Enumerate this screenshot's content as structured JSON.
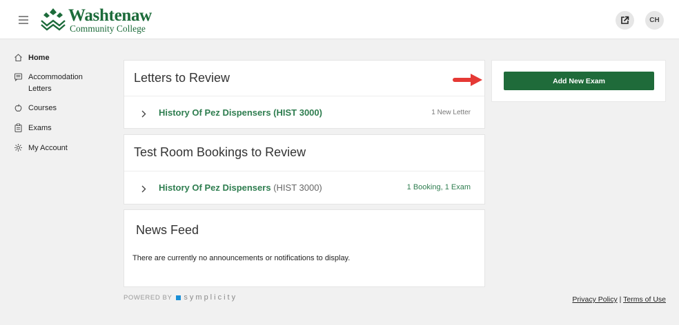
{
  "header": {
    "logo_name": "Washtenaw",
    "logo_sub": "Community College",
    "user_initials": "CH"
  },
  "sidebar": {
    "items": [
      {
        "label": "Home",
        "icon": "home-icon",
        "active": true
      },
      {
        "label": "Accommodation Letters",
        "icon": "letters-icon",
        "active": false
      },
      {
        "label": "Courses",
        "icon": "apple-icon",
        "active": false
      },
      {
        "label": "Exams",
        "icon": "clipboard-icon",
        "active": false
      },
      {
        "label": "My Account",
        "icon": "gear-icon",
        "active": false
      }
    ]
  },
  "letters": {
    "title": "Letters to Review",
    "rows": [
      {
        "course": "History Of Pez Dispensers (HIST 3000)",
        "meta": "1 New Letter"
      }
    ]
  },
  "bookings": {
    "title": "Test Room Bookings to Review",
    "rows": [
      {
        "course": "History Of Pez Dispensers",
        "code": "(HIST 3000)",
        "meta": "1 Booking, 1 Exam"
      }
    ]
  },
  "news": {
    "title": "News Feed",
    "empty_text": "There are currently no announcements or notifications to display."
  },
  "actions": {
    "add_exam_label": "Add New Exam"
  },
  "footer": {
    "powered_by": "POWERED BY",
    "brand": "symplicity",
    "privacy": "Privacy Policy",
    "separator": "|",
    "terms": "Terms of Use"
  },
  "colors": {
    "brand_green": "#1f6b3a",
    "link_green": "#2e7d4f",
    "arrow_red": "#e53935"
  }
}
